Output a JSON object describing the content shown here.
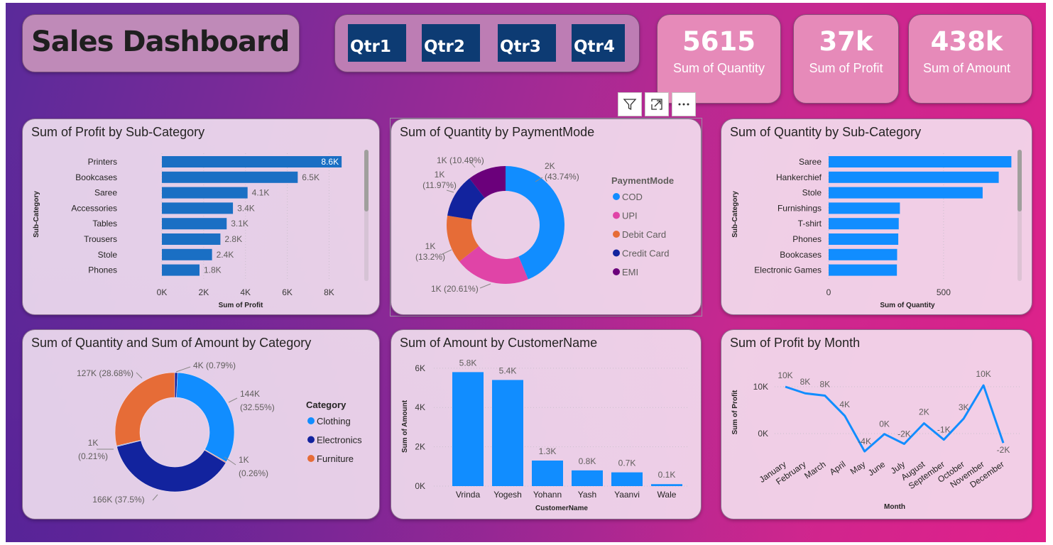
{
  "header": {
    "title": "Sales Dashboard"
  },
  "quarters": [
    "Qtr1",
    "Qtr2",
    "Qtr3",
    "Qtr4"
  ],
  "kpis": [
    {
      "value": "5615",
      "label": "Sum of Quantity"
    },
    {
      "value": "37k",
      "label": "Sum of Profit"
    },
    {
      "value": "438k",
      "label": "Sum of Amount"
    }
  ],
  "visual_toolbar": {
    "icons": [
      "filter-icon",
      "focus-mode-icon",
      "more-options-icon"
    ]
  },
  "colors": {
    "bar_dark": "#1a6fc4",
    "bar_light": "#118dff",
    "cod": "#118dff",
    "upi": "#e044a7",
    "debit_card": "#e66c37",
    "credit_card": "#12239e",
    "emi": "#6b007b",
    "clothing": "#118dff",
    "electronics": "#12239e",
    "furniture": "#e66c37"
  },
  "chart_data": [
    {
      "type": "bar",
      "orientation": "horizontal",
      "title": "Sum of Profit by Sub-Category",
      "xlabel": "Sum of Profit",
      "ylabel": "Sub-Category",
      "categories": [
        "Printers",
        "Bookcases",
        "Saree",
        "Accessories",
        "Tables",
        "Trousers",
        "Stole",
        "Phones"
      ],
      "values": [
        8600,
        6500,
        4100,
        3400,
        3100,
        2800,
        2400,
        1800
      ],
      "data_labels": [
        "8.6K",
        "6.5K",
        "4.1K",
        "3.4K",
        "3.1K",
        "2.8K",
        "2.4K",
        "1.8K"
      ],
      "x_ticks": [
        "0K",
        "2K",
        "4K",
        "6K",
        "8K"
      ],
      "xlim": [
        0,
        8800
      ]
    },
    {
      "type": "pie",
      "variant": "donut",
      "title": "Sum of Quantity by PaymentMode",
      "legend_title": "PaymentMode",
      "legend_position": "right",
      "categories": [
        "COD",
        "UPI",
        "Debit Card",
        "Credit Card",
        "EMI"
      ],
      "values": [
        43.74,
        20.61,
        13.2,
        11.97,
        10.49
      ],
      "data_labels": [
        "2K (43.74%)",
        "1K (20.61%)",
        "1K (13.2%)",
        "1K (11.97%)",
        "1K (10.49%)"
      ]
    },
    {
      "type": "bar",
      "orientation": "horizontal",
      "title": "Sum of Quantity by Sub-Category",
      "xlabel": "Sum of Quantity",
      "ylabel": "Sub-Category",
      "categories": [
        "Saree",
        "Hankerchief",
        "Stole",
        "Furnishings",
        "T-shirt",
        "Phones",
        "Bookcases",
        "Electronic Games"
      ],
      "values": [
        795,
        740,
        670,
        310,
        305,
        303,
        298,
        297
      ],
      "x_ticks": [
        "0",
        "500"
      ],
      "xlim": [
        0,
        800
      ]
    },
    {
      "type": "pie",
      "variant": "donut",
      "title": "Sum of Quantity and Sum of Amount by Category",
      "legend_title": "Category",
      "legend_position": "right",
      "slices": [
        {
          "category": "Electronics",
          "measure": "Sum of Quantity",
          "value": 0.79,
          "label": "4K (0.79%)"
        },
        {
          "category": "Clothing",
          "measure": "Sum of Amount",
          "value": 32.55,
          "label": "144K (32.55%)"
        },
        {
          "category": "Furniture",
          "measure": "Sum of Quantity",
          "value": 0.26,
          "label": "1K (0.26%)"
        },
        {
          "category": "Electronics",
          "measure": "Sum of Amount",
          "value": 37.5,
          "label": "166K (37.5%)"
        },
        {
          "category": "Clothing",
          "measure": "Sum of Quantity",
          "value": 0.21,
          "label": "1K (0.21%)"
        },
        {
          "category": "Furniture",
          "measure": "Sum of Amount",
          "value": 28.68,
          "label": "127K (28.68%)"
        }
      ],
      "legend": [
        "Clothing",
        "Electronics",
        "Furniture"
      ]
    },
    {
      "type": "bar",
      "orientation": "vertical",
      "title": "Sum of Amount by CustomerName",
      "xlabel": "CustomerName",
      "ylabel": "Sum of Amount",
      "categories": [
        "Vrinda",
        "Yogesh",
        "Yohann",
        "Yash",
        "Yaanvi",
        "Wale"
      ],
      "values": [
        5800,
        5400,
        1300,
        800,
        700,
        100
      ],
      "data_labels": [
        "5.8K",
        "5.4K",
        "1.3K",
        "0.8K",
        "0.7K",
        "0.1K"
      ],
      "y_ticks": [
        "0K",
        "2K",
        "4K",
        "6K"
      ],
      "ylim": [
        0,
        6500
      ]
    },
    {
      "type": "line",
      "title": "Sum of Profit by Month",
      "xlabel": "Month",
      "ylabel": "Sum of Profit",
      "categories": [
        "January",
        "February",
        "March",
        "April",
        "May",
        "June",
        "July",
        "August",
        "September",
        "October",
        "November",
        "December"
      ],
      "values": [
        10000,
        8600,
        8100,
        3800,
        -3800,
        -100,
        -2200,
        2200,
        -1300,
        3200,
        10300,
        -2000
      ],
      "data_labels": [
        "10K",
        "8K",
        "8K",
        "4K",
        "-4K",
        "0K",
        "-2K",
        "2K",
        "-1K",
        "3K",
        "10K",
        "-2K"
      ],
      "y_ticks": [
        "0K",
        "10K"
      ],
      "ylim": [
        -5000,
        11000
      ]
    }
  ]
}
